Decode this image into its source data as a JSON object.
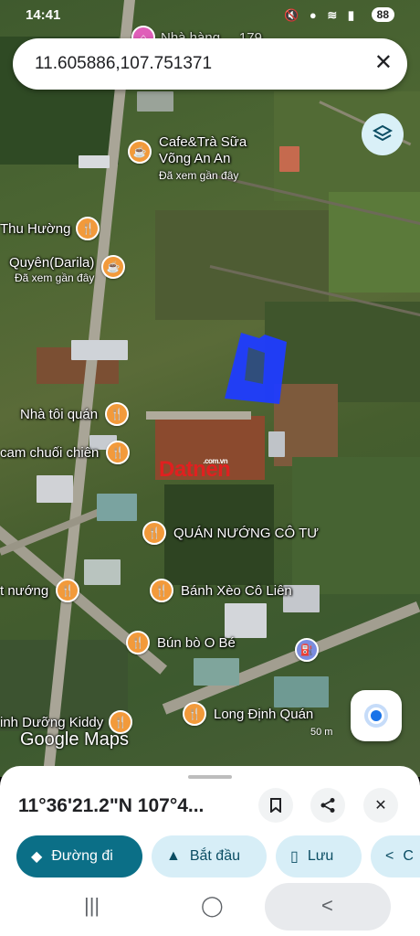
{
  "status_bar": {
    "time": "14:41",
    "icons": [
      "mute-icon",
      "location-icon",
      "wifi-icon",
      "signal-icon"
    ],
    "battery": "88"
  },
  "search": {
    "query": "11.605886,107.751371"
  },
  "poi": {
    "top_partial": "Nhà hàng ... 179",
    "cafe_vong_an_an": {
      "name": "Cafe&Trà Sữa",
      "name2": "Võng An An",
      "sub": "Đã xem gần đây"
    },
    "thu_huong": {
      "name": "Thu Hường"
    },
    "quyen_darila": {
      "name": "Quyên(Darila)",
      "sub": "Đã xem gần đây"
    },
    "nha_toi_quan": {
      "name": "Nhà tôi quán"
    },
    "cam_chuoi_chien": {
      "name": "cam chuối chiên"
    },
    "quan_nuong_co_tu": {
      "name": "QUÁN NƯỚNG CÔ TƯ"
    },
    "t_nuong": {
      "name": "t nướng"
    },
    "banh_xeo": {
      "name": "Bánh Xèo Cô Liên"
    },
    "bun_bo": {
      "name": "Bún bò O Bé"
    },
    "dinh_duong_kiddy": {
      "name": "inh Dưỡng Kiddy"
    },
    "long_dinh_quan": {
      "name": "Long Định Quán"
    }
  },
  "map": {
    "watermark": "Datnen",
    "watermark_small": ".com.vn",
    "attribution": "Google Maps",
    "scale": "50 m",
    "parcel_color": "#1f3cff"
  },
  "sheet": {
    "coordinates": "11°36'21.2\"N 107°4...",
    "actions": {
      "directions": "Đường đi",
      "start": "Bắt đầu",
      "save": "Lưu",
      "share_partial": "C"
    }
  },
  "colors": {
    "poi_orange": "#f29a3b",
    "primary_button": "#0b6f87",
    "secondary_button": "#d7eef7",
    "location_blue": "#1a73e8"
  }
}
